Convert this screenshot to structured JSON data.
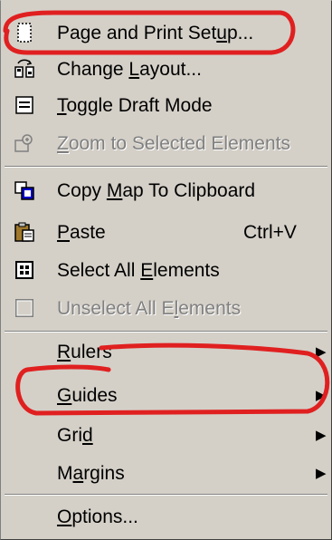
{
  "menu": {
    "items": [
      {
        "pre": "Page and Print Set",
        "acc": "u",
        "post": "p...",
        "shortcut": "",
        "submenu": false,
        "disabled": false,
        "icon": "page-setup-icon"
      },
      {
        "pre": "Change ",
        "acc": "L",
        "post": "ayout...",
        "shortcut": "",
        "submenu": false,
        "disabled": false,
        "icon": "change-layout-icon"
      },
      {
        "pre": "",
        "acc": "T",
        "post": "oggle Draft Mode",
        "shortcut": "",
        "submenu": false,
        "disabled": false,
        "icon": "draft-mode-icon"
      },
      {
        "pre": "",
        "acc": "Z",
        "post": "oom to Selected Elements",
        "shortcut": "",
        "submenu": false,
        "disabled": true,
        "icon": "zoom-selected-icon"
      },
      {
        "pre": "Copy ",
        "acc": "M",
        "post": "ap To Clipboard",
        "shortcut": "",
        "submenu": false,
        "disabled": false,
        "icon": "copy-map-icon"
      },
      {
        "pre": "",
        "acc": "P",
        "post": "aste",
        "shortcut": "Ctrl+V",
        "submenu": false,
        "disabled": false,
        "icon": "paste-icon"
      },
      {
        "pre": "Select All ",
        "acc": "E",
        "post": "lements",
        "shortcut": "",
        "submenu": false,
        "disabled": false,
        "icon": "select-all-icon"
      },
      {
        "pre": "Unselect All E",
        "acc": "l",
        "post": "ements",
        "shortcut": "",
        "submenu": false,
        "disabled": true,
        "icon": "unselect-all-icon"
      },
      {
        "pre": "",
        "acc": "R",
        "post": "ulers",
        "shortcut": "",
        "submenu": true,
        "disabled": false,
        "icon": ""
      },
      {
        "pre": "",
        "acc": "G",
        "post": "uides",
        "shortcut": "",
        "submenu": true,
        "disabled": false,
        "icon": ""
      },
      {
        "pre": "Gri",
        "acc": "d",
        "post": "",
        "shortcut": "",
        "submenu": true,
        "disabled": false,
        "icon": ""
      },
      {
        "pre": "M",
        "acc": "a",
        "post": "rgins",
        "shortcut": "",
        "submenu": true,
        "disabled": false,
        "icon": ""
      },
      {
        "pre": "",
        "acc": "O",
        "post": "ptions...",
        "shortcut": "",
        "submenu": false,
        "disabled": false,
        "icon": ""
      }
    ]
  },
  "colors": {
    "menu_background": "#d4d0c8",
    "disabled_text": "#808080",
    "annotation_stroke": "#e02020"
  }
}
